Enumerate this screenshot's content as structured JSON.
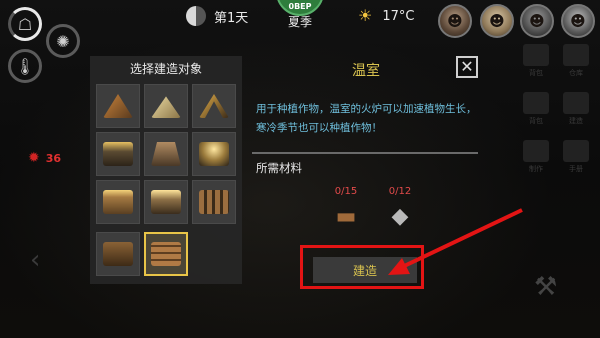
{
  "status_rings": [
    {
      "icon": "stomach-icon",
      "glyph": "☖",
      "active": true
    },
    {
      "icon": "brain-icon",
      "glyph": "✺",
      "active": false
    },
    {
      "icon": "thermometer-icon",
      "glyph": "🌡",
      "active": false
    }
  ],
  "topbar": {
    "day": "第1天",
    "season_badge": "0BEP",
    "season": "夏季",
    "temperature": "17°C"
  },
  "characters": [
    {
      "name": "avatar-1",
      "glyph": "☻"
    },
    {
      "name": "avatar-2",
      "glyph": "☻"
    },
    {
      "name": "avatar-3",
      "glyph": "☻"
    },
    {
      "name": "avatar-4",
      "glyph": "☻"
    }
  ],
  "left_indicator": {
    "value": "36"
  },
  "build_panel": {
    "title": "选择建造对象",
    "slots": [
      {
        "name": "tent-slot",
        "color": "#8a5a2c",
        "selected": false
      },
      {
        "name": "canvas-tent-slot",
        "color": "#cbb37d",
        "selected": false
      },
      {
        "name": "campfire-frame-slot",
        "color": "#6e5a3e",
        "selected": false
      },
      {
        "name": "workbench-slot",
        "color": "#5a4a32",
        "selected": false
      },
      {
        "name": "stone-pile-slot",
        "color": "#7a6046",
        "selected": false
      },
      {
        "name": "lamp-slot",
        "color": "#d2b463",
        "selected": false
      },
      {
        "name": "lantern-crate-slot",
        "color": "#a57a42",
        "selected": false
      },
      {
        "name": "forge-slot",
        "color": "#8c6f46",
        "selected": false
      },
      {
        "name": "fence-slot",
        "color": "#7d5b36",
        "selected": false
      },
      {
        "name": "storage-box-slot",
        "color": "#6b4a2b",
        "selected": false
      },
      {
        "name": "greenhouse-slot",
        "color": "#9b6a3c",
        "selected": true
      }
    ]
  },
  "detail": {
    "title": "温室",
    "description": "用于种植作物，温室的火炉可以加速植物生长，寒冷季节也可以种植作物！",
    "materials_label": "所需材料",
    "materials": [
      {
        "name": "wood",
        "count": "0/15",
        "glyph": "▬"
      },
      {
        "name": "stone",
        "count": "0/12",
        "glyph": "◆"
      }
    ],
    "build_button": "建造"
  },
  "side_menu": [
    {
      "label": "背包"
    },
    {
      "label": "仓库"
    },
    {
      "label": "背包"
    },
    {
      "label": "建造"
    },
    {
      "label": "制作"
    },
    {
      "label": "手册"
    }
  ]
}
